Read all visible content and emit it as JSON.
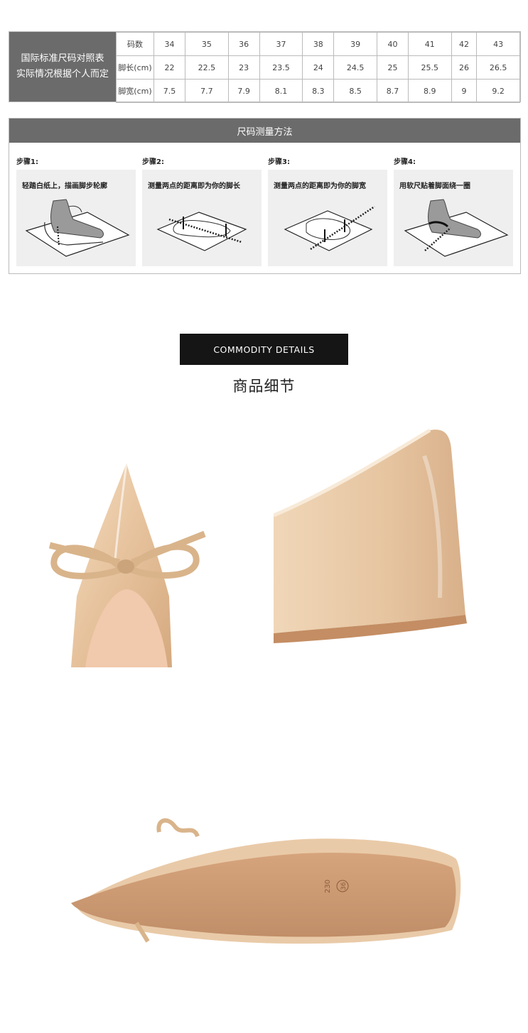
{
  "size_chart": {
    "label_line1": "国际标准尺码对照表",
    "label_line2": "实际情况根据个人而定",
    "rows": [
      {
        "head": "码数",
        "cells": [
          "34",
          "35",
          "36",
          "37",
          "38",
          "39",
          "40",
          "41",
          "42",
          "43"
        ]
      },
      {
        "head": "脚长(cm)",
        "cells": [
          "22",
          "22.5",
          "23",
          "23.5",
          "24",
          "24.5",
          "25",
          "25.5",
          "26",
          "26.5"
        ]
      },
      {
        "head": "脚宽(cm)",
        "cells": [
          "7.5",
          "7.7",
          "7.9",
          "8.1",
          "8.3",
          "8.5",
          "8.7",
          "8.9",
          "9",
          "9.2"
        ]
      }
    ]
  },
  "measure": {
    "title": "尺码测量方法",
    "steps": [
      {
        "title": "步骤1:",
        "desc": "轻踏白纸上，描画脚步轮廓"
      },
      {
        "title": "步骤2:",
        "desc": "测量两点的距离即为你的脚长"
      },
      {
        "title": "步骤3:",
        "desc": "测量两点的距离即为你的脚宽"
      },
      {
        "title": "步骤4:",
        "desc": "用软尺贴着脚面绕一圈"
      }
    ]
  },
  "commodity": {
    "title_en": "COMMODITY DETAILS",
    "title_cn": "商品细节"
  },
  "sole_print": {
    "size_mark": "230",
    "size_circle": "36"
  },
  "colors": {
    "bar": "#6b6b6b",
    "nude": "#e8c9a6",
    "sole": "#c59674",
    "black": "#151515"
  }
}
